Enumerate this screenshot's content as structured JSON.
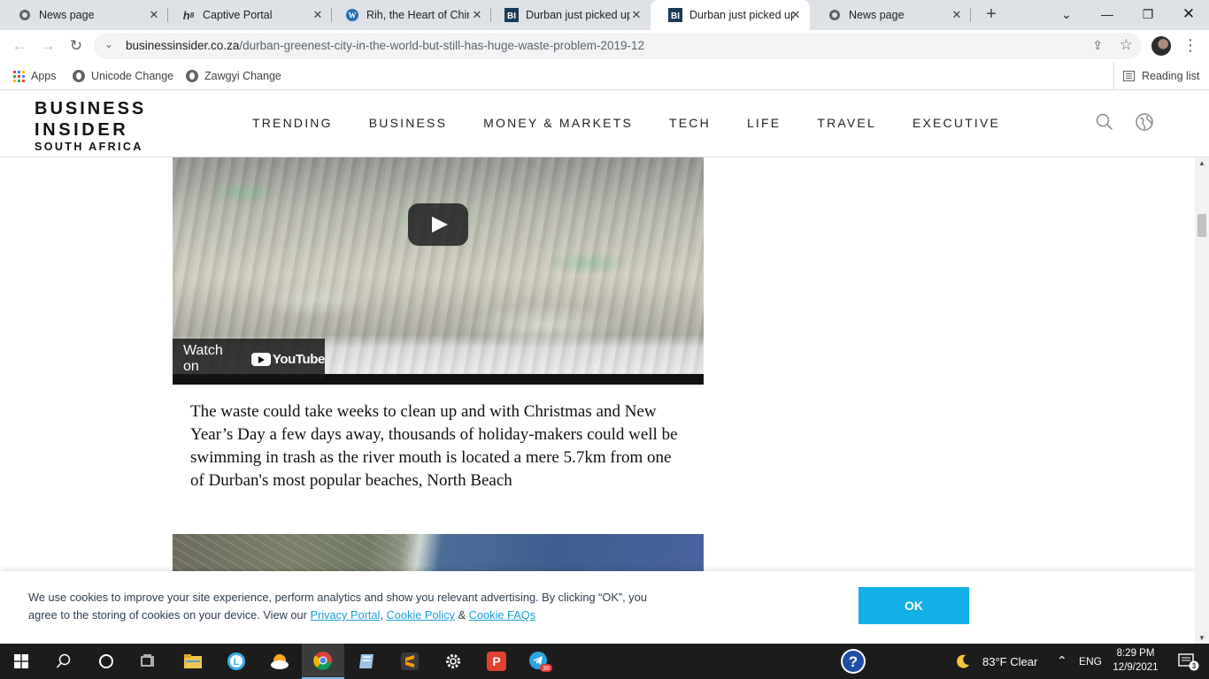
{
  "browser": {
    "tabs": [
      {
        "title": "News page",
        "favicon": "globe-icon"
      },
      {
        "title": "Captive Portal",
        "favicon": "h8-icon"
      },
      {
        "title": "Rih, the Heart of Chin",
        "favicon": "wordpress-icon"
      },
      {
        "title": "Durban just picked up",
        "favicon": "bi-icon"
      },
      {
        "title": "Durban just picked up",
        "favicon": "bi-icon",
        "active": true
      },
      {
        "title": "News page",
        "favicon": "globe-icon"
      }
    ],
    "address": {
      "domain": "businessinsider.co.za",
      "path": "/durban-greenest-city-in-the-world-but-still-has-huge-waste-problem-2019-12"
    },
    "bookmarks": [
      "Apps",
      "Unicode Change",
      "Zawgyi Change"
    ],
    "reading_list": "Reading list"
  },
  "site": {
    "logo": {
      "line1": "BUSINESS",
      "line2": "INSIDER",
      "line3": "SOUTH AFRICA"
    },
    "nav": [
      "TRENDING",
      "BUSINESS",
      "MONEY & MARKETS",
      "TECH",
      "LIFE",
      "TRAVEL",
      "EXECUTIVE"
    ]
  },
  "video": {
    "watch_on": "Watch on",
    "brand": "YouTube"
  },
  "article": {
    "paragraph": "The waste could take weeks to clean up and with Christmas and New Year’s Day a few days away, thousands of holiday-makers could well be swimming in trash as the river mouth is located a mere 5.7km from one of Durban's most popular beaches, North Beach"
  },
  "cookie_banner": {
    "text_part1": "We use cookies to improve your site experience, perform analytics and show you relevant advertising. By clicking “OK”, you agree to the storing of cookies on your device. View our ",
    "link1": "Privacy Portal",
    "sep1": ", ",
    "link2": "Cookie Policy",
    "sep2": " & ",
    "link3": "Cookie FAQs",
    "ok_label": "OK"
  },
  "taskbar": {
    "weather": "83°F  Clear",
    "language": "ENG",
    "time": "8:29 PM",
    "date": "12/9/2021",
    "notification_count": "3",
    "telegram_badge": "36"
  },
  "colors": {
    "accent": "#12b0e6",
    "link": "#1a9fd6",
    "taskbar": "#1c1c1c"
  }
}
